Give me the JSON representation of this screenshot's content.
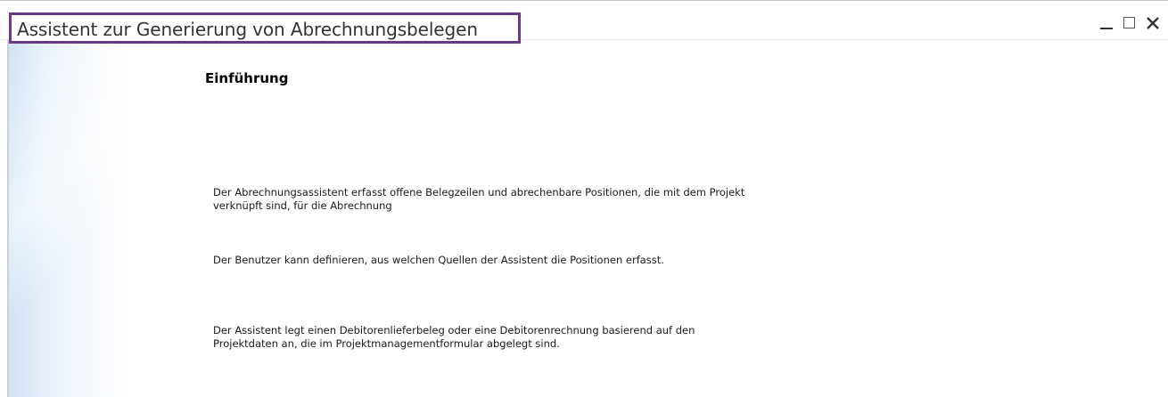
{
  "window": {
    "title": "Assistent zur Generierung von Abrechnungsbelegen",
    "controls": [
      "minimize-icon",
      "maximize-icon",
      "close-icon"
    ]
  },
  "colors": {
    "title_highlight_border": "#6b3a86",
    "side_gradient": "#cfe3f4"
  },
  "page": {
    "heading": "Einführung",
    "paragraphs": [
      {
        "line1": "Der Abrechnungsassistent erfasst offene Belegzeilen und abrechenbare Positionen, die mit dem Projekt",
        "line2": "verknüpft sind, für die Abrechnung"
      },
      {
        "line1": "Der Benutzer kann definieren, aus welchen Quellen der Assistent die Positionen erfasst.",
        "line2": ""
      },
      {
        "line1": "Der Assistent legt einen Debitorenlieferbeleg oder eine Debitorenrechnung basierend auf den",
        "line2": "Projektdaten an, die im Projektmanagementformular abgelegt sind."
      }
    ]
  }
}
